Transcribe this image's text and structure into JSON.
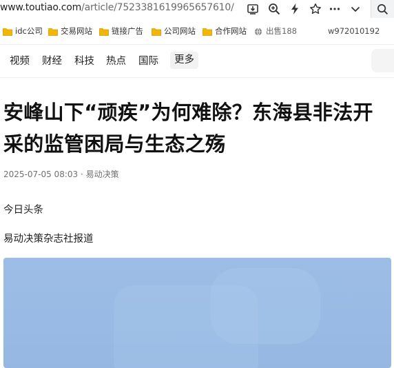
{
  "browser": {
    "url_host": "www.toutiao.com",
    "url_path": "/article/7523381619965657610/",
    "toolbar_icons": [
      "download-icon",
      "zoom-icon",
      "lightning-icon",
      "star-icon",
      "more-icon",
      "chevron-down-icon",
      "search-icon"
    ]
  },
  "bookmarks": {
    "items": [
      {
        "label": "idc公司"
      },
      {
        "label": "交易网站"
      },
      {
        "label": "链接广告"
      },
      {
        "label": "公司网站"
      },
      {
        "label": "合作网站"
      },
      {
        "label": "出售188"
      }
    ],
    "user": "w972010192"
  },
  "nav": {
    "items": [
      "视频",
      "财经",
      "科技",
      "热点",
      "国际"
    ],
    "more": "更多"
  },
  "article": {
    "title": "安峰山下“顽疾”为何难除？东海县非法开采的监管困局与生态之殇",
    "meta": "2025-07-05 08:03 · 易动决策",
    "paragraphs": [
      "今日头条",
      "易动决策杂志社报道"
    ]
  },
  "colors": {
    "folder": "#f2b705",
    "image_bg": "#9bbbe5"
  }
}
